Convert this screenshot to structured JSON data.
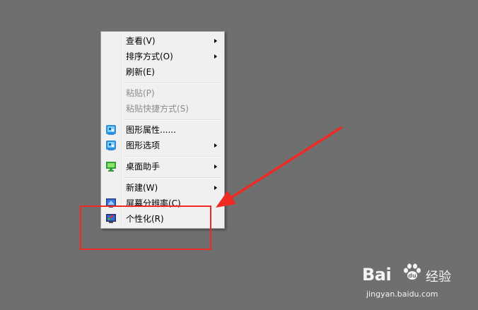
{
  "context_menu": {
    "items": [
      {
        "label": "查看(V)",
        "has_submenu": true,
        "enabled": true
      },
      {
        "label": "排序方式(O)",
        "has_submenu": true,
        "enabled": true
      },
      {
        "label": "刷新(E)",
        "has_submenu": false,
        "enabled": true
      },
      {
        "label": "粘贴(P)",
        "has_submenu": false,
        "enabled": false
      },
      {
        "label": "粘贴快捷方式(S)",
        "has_submenu": false,
        "enabled": false
      },
      {
        "label": "图形属性......",
        "icon": "intel-graphics-icon",
        "has_submenu": false,
        "enabled": true
      },
      {
        "label": "图形选项",
        "icon": "intel-graphics-icon",
        "has_submenu": true,
        "enabled": true
      },
      {
        "label": "桌面助手",
        "icon": "desktop-assistant-icon",
        "has_submenu": true,
        "enabled": true
      },
      {
        "label": "新建(W)",
        "has_submenu": true,
        "enabled": true
      },
      {
        "label": "屏幕分辨率(C)",
        "icon": "screen-resolution-icon",
        "has_submenu": false,
        "enabled": true
      },
      {
        "label": "个性化(R)",
        "icon": "personalize-icon",
        "has_submenu": false,
        "enabled": true
      }
    ]
  },
  "annotation": {
    "highlight_color": "#ee2a24",
    "highlighted_item": "个性化(R)"
  },
  "watermark": {
    "brand_left": "Bai",
    "brand_right": "经验",
    "url": "jingyan.baidu.com"
  },
  "colors": {
    "desktop": "#6f6f6f",
    "menu_bg": "#f0f0f0",
    "disabled_text": "#8d8d8d"
  }
}
